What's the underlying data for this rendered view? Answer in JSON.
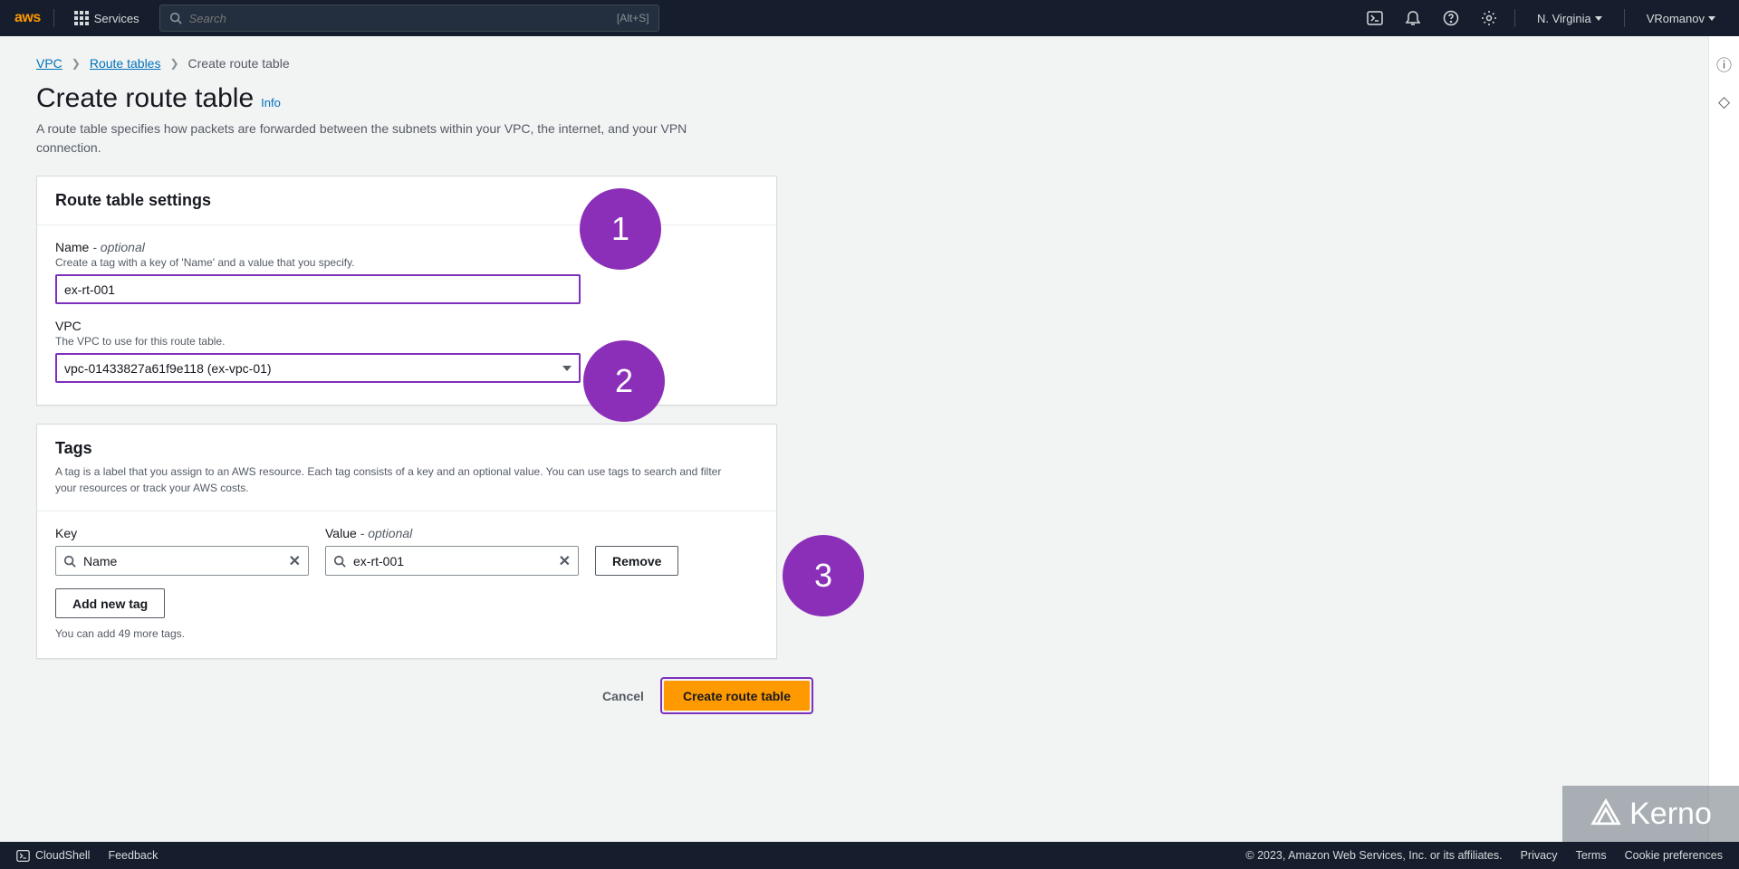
{
  "nav": {
    "services": "Services",
    "search_placeholder": "Search",
    "search_hint": "[Alt+S]",
    "region": "N. Virginia",
    "user": "VRomanov"
  },
  "breadcrumb": {
    "vpc": "VPC",
    "route_tables": "Route tables",
    "current": "Create route table"
  },
  "page": {
    "title": "Create route table",
    "info": "Info",
    "subtitle": "A route table specifies how packets are forwarded between the subnets within your VPC, the internet, and your VPN connection."
  },
  "settings": {
    "heading": "Route table settings",
    "name_label": "Name",
    "optional": "- optional",
    "name_help": "Create a tag with a key of 'Name' and a value that you specify.",
    "name_value": "ex-rt-001",
    "vpc_label": "VPC",
    "vpc_help": "The VPC to use for this route table.",
    "vpc_value": "vpc-01433827a61f9e118 (ex-vpc-01)"
  },
  "tags": {
    "heading": "Tags",
    "desc": "A tag is a label that you assign to an AWS resource. Each tag consists of a key and an optional value. You can use tags to search and filter your resources or track your AWS costs.",
    "key_label": "Key",
    "value_label": "Value",
    "value_optional": "- optional",
    "key_value": "Name",
    "val_value": "ex-rt-001",
    "remove": "Remove",
    "add_new": "Add new tag",
    "limit": "You can add 49 more tags."
  },
  "actions": {
    "cancel": "Cancel",
    "create": "Create route table"
  },
  "footer": {
    "cloudshell": "CloudShell",
    "feedback": "Feedback",
    "copyright": "© 2023, Amazon Web Services, Inc. or its affiliates.",
    "privacy": "Privacy",
    "terms": "Terms",
    "cookie": "Cookie preferences"
  },
  "annotations": {
    "a1": "1",
    "a2": "2",
    "a3": "3"
  },
  "watermark": "Kerno"
}
